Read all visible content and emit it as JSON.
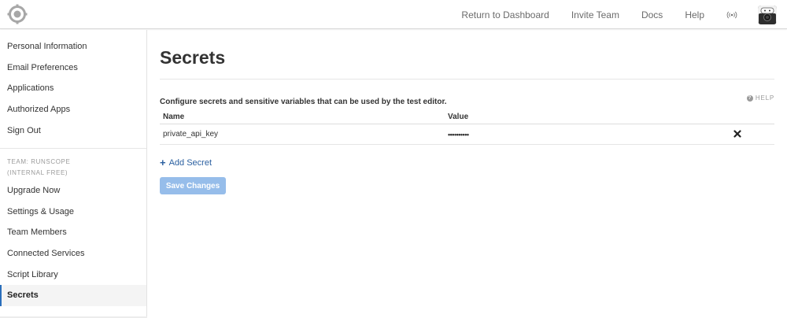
{
  "header": {
    "nav": [
      "Return to Dashboard",
      "Invite Team",
      "Docs",
      "Help"
    ],
    "logo_icon": "gear-logo-icon",
    "broadcast_icon": "broadcast-icon"
  },
  "sidebar": {
    "account_items": [
      "Personal Information",
      "Email Preferences",
      "Applications",
      "Authorized Apps",
      "Sign Out"
    ],
    "team_label_line1": "TEAM: RUNSCOPE",
    "team_label_line2": "(INTERNAL FREE)",
    "team_items": [
      "Upgrade Now",
      "Settings & Usage",
      "Team Members",
      "Connected Services",
      "Script Library",
      "Secrets"
    ],
    "active_item": "Secrets",
    "accent_color": "#2a6ebb"
  },
  "main": {
    "title": "Secrets",
    "description": "Configure secrets and sensitive variables that can be used by the test editor.",
    "help_label": "HELP",
    "table": {
      "headers": [
        "Name",
        "Value"
      ],
      "rows": [
        {
          "name": "private_api_key",
          "value": "••••••••••"
        }
      ]
    },
    "add_label": "Add Secret",
    "save_label": "Save Changes",
    "save_color": "#96bdea",
    "link_color": "#2a5fa0"
  }
}
